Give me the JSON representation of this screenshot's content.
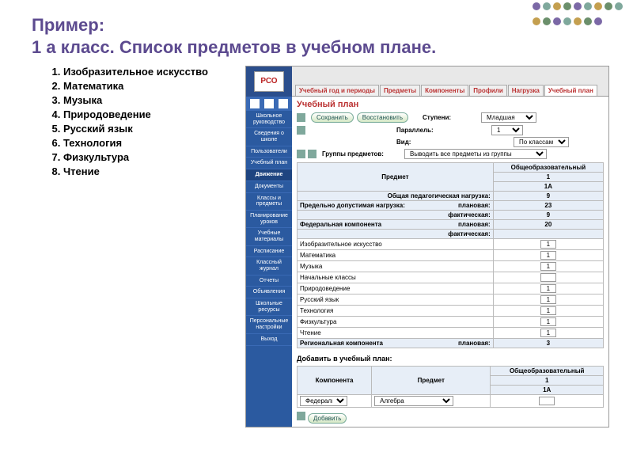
{
  "slide": {
    "title": "Пример:\n1 а класс. Список предметов в учебном плане.",
    "subjects": [
      "Изобразительное искусство",
      "Математика",
      "Музыка",
      "Природоведение",
      "Русский язык",
      "Технология",
      "Физкультура",
      "Чтение"
    ]
  },
  "app": {
    "logo": "РСО",
    "tabs": [
      "Учебный год и периоды",
      "Предметы",
      "Компоненты",
      "Профили",
      "Нагрузка",
      "Учебный план"
    ],
    "active_tab": 5,
    "sidebar": {
      "items": [
        "Школьное руководство",
        "Сведения о школе",
        "Пользователи",
        "Учебный план"
      ],
      "section": "Движение",
      "items2": [
        "Документы",
        "Классы и предметы",
        "Планирование уроков",
        "Учебные материалы",
        "Расписание",
        "Классный журнал",
        "Отчеты",
        "Объявления",
        "Школьные ресурсы",
        "Персональные настройки",
        "Выход"
      ]
    },
    "page_title": "Учебный план",
    "buttons": {
      "save": "Сохранить",
      "restore": "Восстановить",
      "add": "Добавить"
    },
    "form": {
      "steps_lbl": "Ступени:",
      "steps_val": "Младшая",
      "parallel_lbl": "Параллель:",
      "parallel_val": "1",
      "type_lbl": "Вид:",
      "type_val": "По классам",
      "groups_lbl": "Группы предметов:",
      "groups_val": "Выводить все предметы из группы"
    },
    "table": {
      "col_subject": "Предмет",
      "col_group": "Общеобразовательный",
      "col_level": "1",
      "col_class": "1А",
      "rows": [
        {
          "label": "Общая педагогическая нагрузка:",
          "value": "9",
          "heading": true
        },
        {
          "label": "Предельно допустимая нагрузка:",
          "sub": "плановая:",
          "value": "23",
          "heading": true
        },
        {
          "label": "",
          "sub": "фактическая:",
          "value": "9",
          "heading": true
        },
        {
          "label": "Федеральная компонента",
          "sub": "плановая:",
          "value": "20",
          "heading": true
        },
        {
          "label": "",
          "sub": "фактическая:",
          "value": "",
          "heading": true
        },
        {
          "label": "Изобразительное искусство",
          "input": "1"
        },
        {
          "label": "Математика",
          "input": "1"
        },
        {
          "label": "Музыка",
          "input": "1"
        },
        {
          "label": "Начальные классы",
          "input": ""
        },
        {
          "label": "Природоведение",
          "input": "1"
        },
        {
          "label": "Русский язык",
          "input": "1"
        },
        {
          "label": "Технология",
          "input": "1"
        },
        {
          "label": "Физкультура",
          "input": "1"
        },
        {
          "label": "Чтение",
          "input": "1"
        },
        {
          "label": "Региональная компонента",
          "sub": "плановая:",
          "value": "3",
          "heading": true
        }
      ]
    },
    "add_section": {
      "title": "Добавить в учебный план:",
      "col_comp": "Компонента",
      "col_subj": "Предмет",
      "col_group": "Общеобразовательный",
      "col_level": "1",
      "col_class": "1А",
      "comp_val": "Федеральна",
      "subj_val": "Алгебра"
    }
  }
}
